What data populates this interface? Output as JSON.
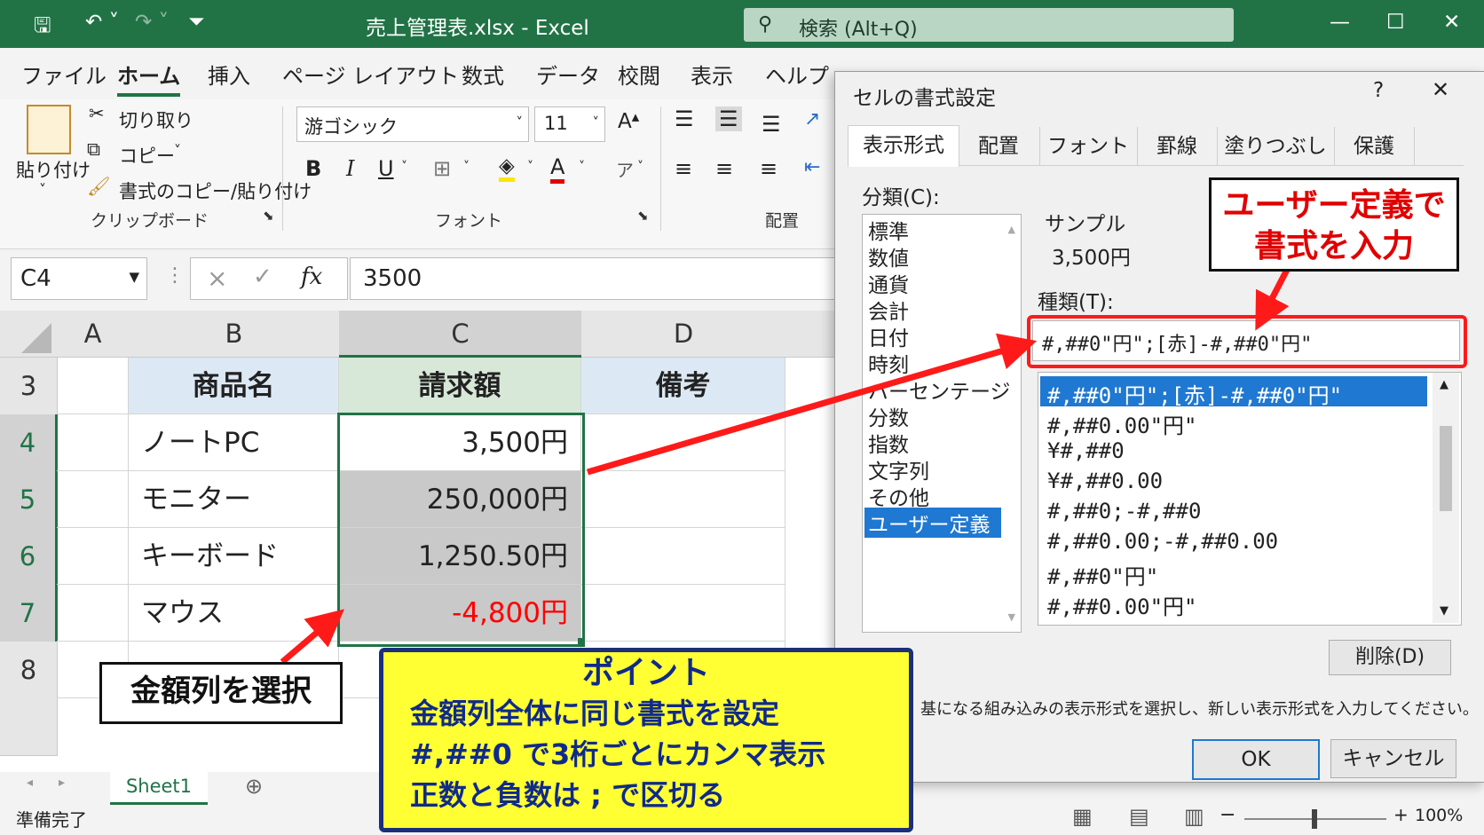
{
  "window": {
    "file_title": "売上管理表.xlsx  -  Excel",
    "search_placeholder": "検索 (Alt+Q)"
  },
  "ribbon": {
    "tabs": [
      "ファイル",
      "ホーム",
      "挿入",
      "ページ レイアウト",
      "数式",
      "データ",
      "校閲",
      "表示",
      "ヘルプ"
    ],
    "active_tab": "ホーム",
    "clipboard": {
      "paste": "貼り付け",
      "cut": "切り取り",
      "copy": "コピー",
      "format_painter": "書式のコピー/貼り付け",
      "group_label": "クリップボード"
    },
    "font": {
      "font_name": "游ゴシック",
      "font_size": "11",
      "group_label": "フォント",
      "bold": "B",
      "italic": "I",
      "underline": "U"
    },
    "alignment": {
      "group_label": "配置"
    }
  },
  "formula_bar": {
    "name_box": "C4",
    "fx": "fx",
    "value": "3500"
  },
  "sheet": {
    "columns": [
      "A",
      "B",
      "C",
      "D"
    ],
    "rows": [
      "3",
      "4",
      "5",
      "6",
      "7",
      "8"
    ],
    "header_row": {
      "b": "商品名",
      "c": "請求額",
      "d": "備考"
    },
    "data": [
      {
        "name": "ノートPC",
        "amount": "3,500円"
      },
      {
        "name": "モニター",
        "amount": "250,000円"
      },
      {
        "name": "キーボード",
        "amount": "1,250.50円"
      },
      {
        "name": "マウス",
        "amount": "-4,800円"
      }
    ],
    "tab_name": "Sheet1",
    "negative_color": "#ff0000",
    "header_fill": "#dce9f5"
  },
  "status": {
    "ready": "準備完了",
    "zoom": "100%"
  },
  "dialog": {
    "title": "セルの書式設定",
    "help": "?",
    "tabs": [
      "表示形式",
      "配置",
      "フォント",
      "罫線",
      "塗りつぶし",
      "保護"
    ],
    "category_label": "分類(C):",
    "categories": [
      "標準",
      "数値",
      "通貨",
      "会計",
      "日付",
      "時刻",
      "パーセンテージ",
      "分数",
      "指数",
      "文字列",
      "その他",
      "ユーザー定義"
    ],
    "selected_category": "ユーザー定義",
    "sample_label": "サンプル",
    "sample_value": "3,500円",
    "type_label": "種類(T):",
    "type_value": "#,##0\"円\";[赤]-#,##0\"円\"",
    "formats": [
      "#,##0\"円\";[赤]-#,##0\"円\"",
      "#,##0.00\"円\"",
      "¥#,##0",
      "¥#,##0.00",
      "#,##0;-#,##0",
      "#,##0.00;-#,##0.00",
      "#,##0\"円\"",
      "#,##0.00\"円\""
    ],
    "delete_button": "削除(D)",
    "hint": "基になる組み込みの表示形式を選択し、新しい表示形式を入力してください。",
    "ok": "OK",
    "cancel": "キャンセル"
  },
  "annotations": {
    "user_defined": [
      "ユーザー定義で",
      "書式を入力"
    ],
    "select_column": "金額列を選択",
    "point_title": "ポイント",
    "point_lines": [
      "金額列全体に同じ書式を設定",
      "#,##0 で3桁ごとにカンマ表示",
      "正数と負数は ; で区切る"
    ],
    "arrow_color": "#ff1a1a"
  }
}
